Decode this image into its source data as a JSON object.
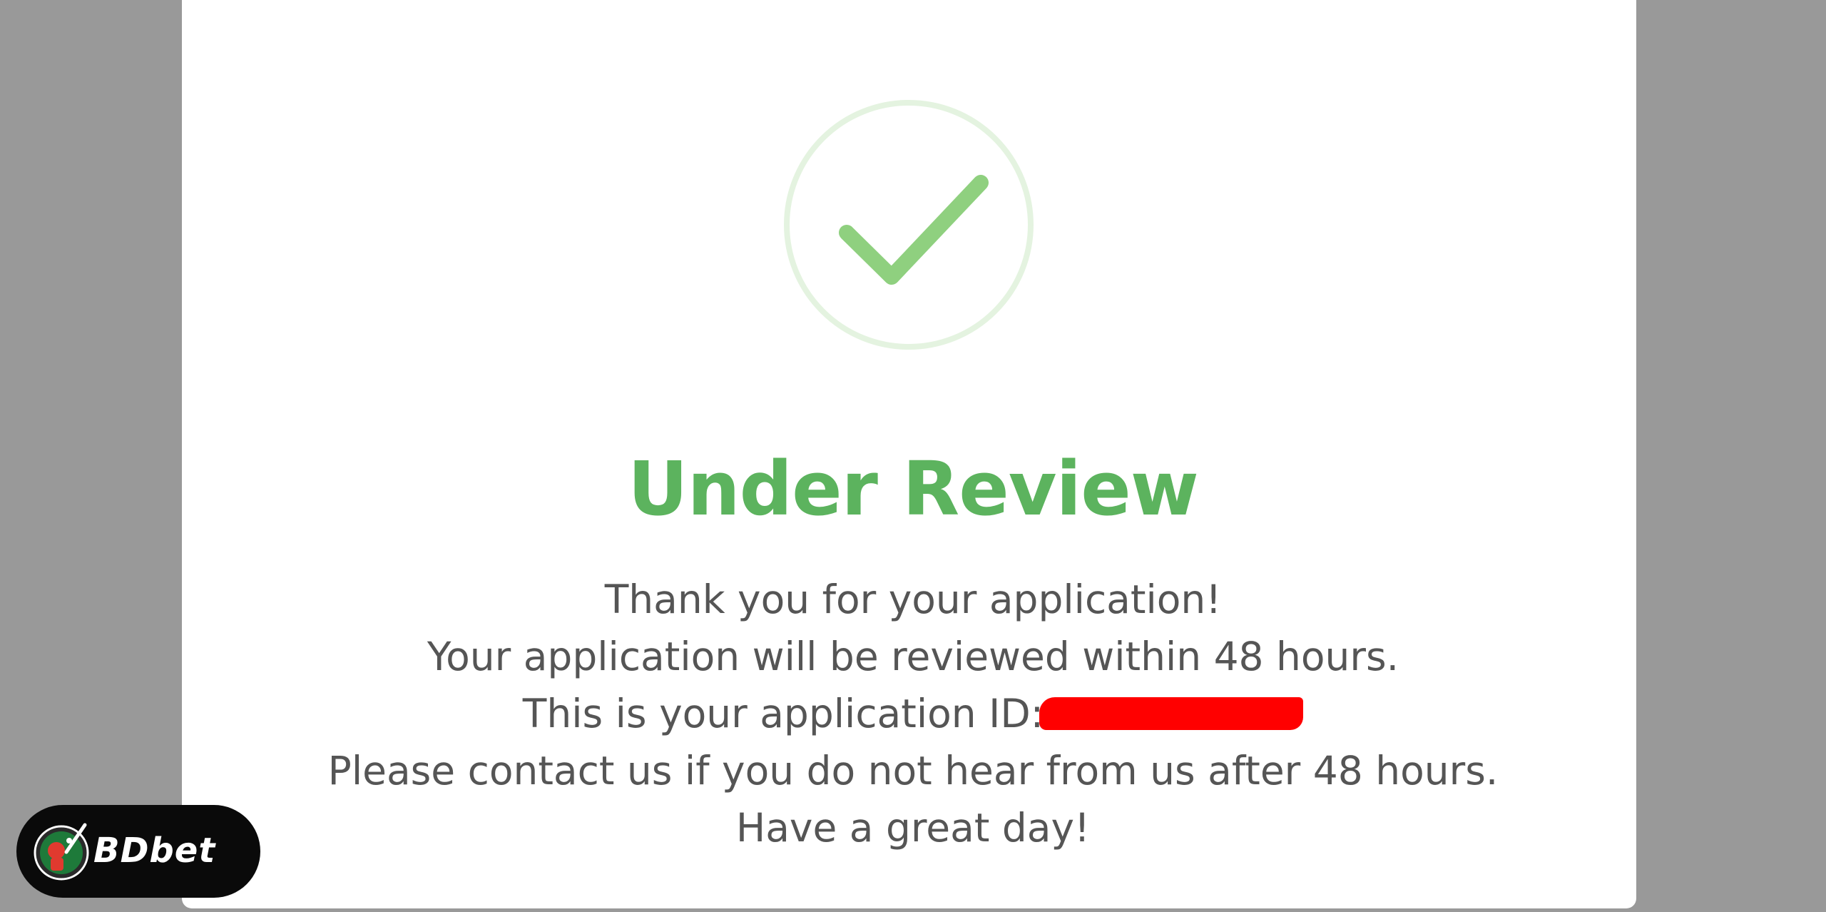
{
  "status": {
    "title": "Under Review",
    "icon": "check-circle-icon",
    "accent_color": "#5cb35e"
  },
  "message": {
    "line1": "Thank you for your application!",
    "line2": "Your application will be reviewed within 48 hours.",
    "line3_prefix": "This is your application ID:",
    "line4": "Please contact us if you do not hear from us after 48 hours.",
    "line5": "Have a great day!"
  },
  "brand": {
    "name": "BDbet",
    "logo_icon": "cricket-player-logo-icon"
  }
}
